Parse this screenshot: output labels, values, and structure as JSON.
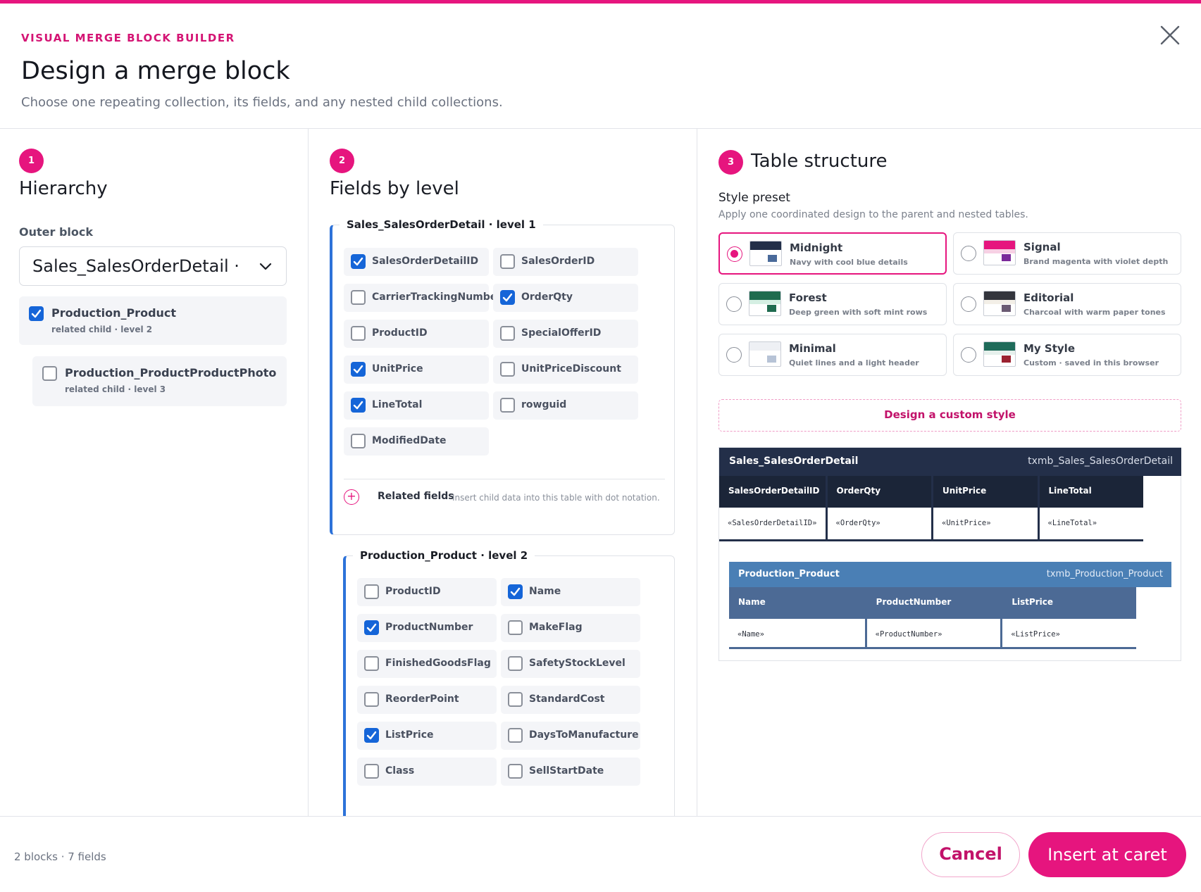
{
  "header": {
    "eyebrow": "VISUAL MERGE BLOCK BUILDER",
    "title": "Design a merge block",
    "subtitle": "Choose one repeating collection, its fields, and any nested child collections."
  },
  "hierarchy": {
    "step": "1",
    "title": "Hierarchy",
    "outer_label": "Outer block",
    "outer_value": "Sales_SalesOrderDetail · root",
    "children": [
      {
        "name": "Production_Product",
        "meta": "related child · level 2",
        "checked": true
      },
      {
        "name": "Production_ProductProductPhoto",
        "meta": "related child · level 3",
        "checked": false
      }
    ]
  },
  "fields": {
    "step": "2",
    "title": "Fields by level",
    "level1": {
      "title": "Sales_SalesOrderDetail · level 1",
      "items": [
        {
          "label": "SalesOrderDetailID",
          "checked": true
        },
        {
          "label": "SalesOrderID",
          "checked": false
        },
        {
          "label": "CarrierTrackingNumber",
          "checked": false
        },
        {
          "label": "OrderQty",
          "checked": true
        },
        {
          "label": "ProductID",
          "checked": false
        },
        {
          "label": "SpecialOfferID",
          "checked": false
        },
        {
          "label": "UnitPrice",
          "checked": true
        },
        {
          "label": "UnitPriceDiscount",
          "checked": false
        },
        {
          "label": "LineTotal",
          "checked": true
        },
        {
          "label": "rowguid",
          "checked": false
        },
        {
          "label": "ModifiedDate",
          "checked": false
        }
      ],
      "related_label": "Related fields",
      "related_hint": "Insert child data into this table with dot notation."
    },
    "level2": {
      "title": "Production_Product · level 2",
      "items": [
        {
          "label": "ProductID",
          "checked": false
        },
        {
          "label": "Name",
          "checked": true
        },
        {
          "label": "ProductNumber",
          "checked": true
        },
        {
          "label": "MakeFlag",
          "checked": false
        },
        {
          "label": "FinishedGoodsFlag",
          "checked": false
        },
        {
          "label": "SafetyStockLevel",
          "checked": false
        },
        {
          "label": "ReorderPoint",
          "checked": false
        },
        {
          "label": "StandardCost",
          "checked": false
        },
        {
          "label": "ListPrice",
          "checked": true
        },
        {
          "label": "DaysToManufacture",
          "checked": false
        },
        {
          "label": "Class",
          "checked": false
        },
        {
          "label": "SellStartDate",
          "checked": false
        }
      ]
    }
  },
  "structure": {
    "step": "3",
    "title": "Table structure",
    "preset_label": "Style preset",
    "preset_hint": "Apply one coordinated design to the parent and nested tables.",
    "presets": [
      {
        "name": "Midnight",
        "desc": "Navy with cool blue details",
        "selected": true,
        "head": "#232f49",
        "mid": "#ffffff",
        "sq": "#4a6a9a"
      },
      {
        "name": "Signal",
        "desc": "Brand magenta with violet depth",
        "selected": false,
        "head": "#e6157e",
        "mid": "#f7d0e4",
        "sq": "#7b2a9a"
      },
      {
        "name": "Forest",
        "desc": "Deep green with soft mint rows",
        "selected": false,
        "head": "#1f6b4f",
        "mid": "#d5efe3",
        "sq": "#1f6b4f"
      },
      {
        "name": "Editorial",
        "desc": "Charcoal with warm paper tones",
        "selected": false,
        "head": "#33353d",
        "mid": "#f3efe7",
        "sq": "#6b5b73"
      },
      {
        "name": "Minimal",
        "desc": "Quiet lines and a light header",
        "selected": false,
        "head": "#eef0f4",
        "mid": "#ffffff",
        "sq": "#b7c3d6"
      },
      {
        "name": "My Style",
        "desc": "Custom · saved in this browser",
        "selected": false,
        "head": "#1f6b5a",
        "mid": "#e6f0ec",
        "sq": "#9b2230"
      }
    ],
    "custom_btn": "Design a custom style",
    "preview": {
      "outer": {
        "title": "Sales_SalesOrderDetail",
        "id": "txmb_Sales_SalesOrderDetail",
        "columns": [
          "SalesOrderDetailID",
          "OrderQty",
          "UnitPrice",
          "LineTotal"
        ],
        "cells": [
          "«SalesOrderDetailID»",
          "«OrderQty»",
          "«UnitPrice»",
          "«LineTotal»"
        ],
        "colors": {
          "head": "#232f49",
          "colhead": "#1b2538"
        }
      },
      "inner": {
        "title": "Production_Product",
        "id": "txmb_Production_Product",
        "columns": [
          "Name",
          "ProductNumber",
          "ListPrice"
        ],
        "cells": [
          "«Name»",
          "«ProductNumber»",
          "«ListPrice»"
        ],
        "colors": {
          "head": "#4a7fb5",
          "colhead": "#4c6a95"
        }
      }
    }
  },
  "footer": {
    "count": "2 blocks · 7 fields",
    "cancel": "Cancel",
    "insert": "Insert at caret"
  },
  "colors": {
    "accent": "#e6157e",
    "check": "#1565d8"
  }
}
